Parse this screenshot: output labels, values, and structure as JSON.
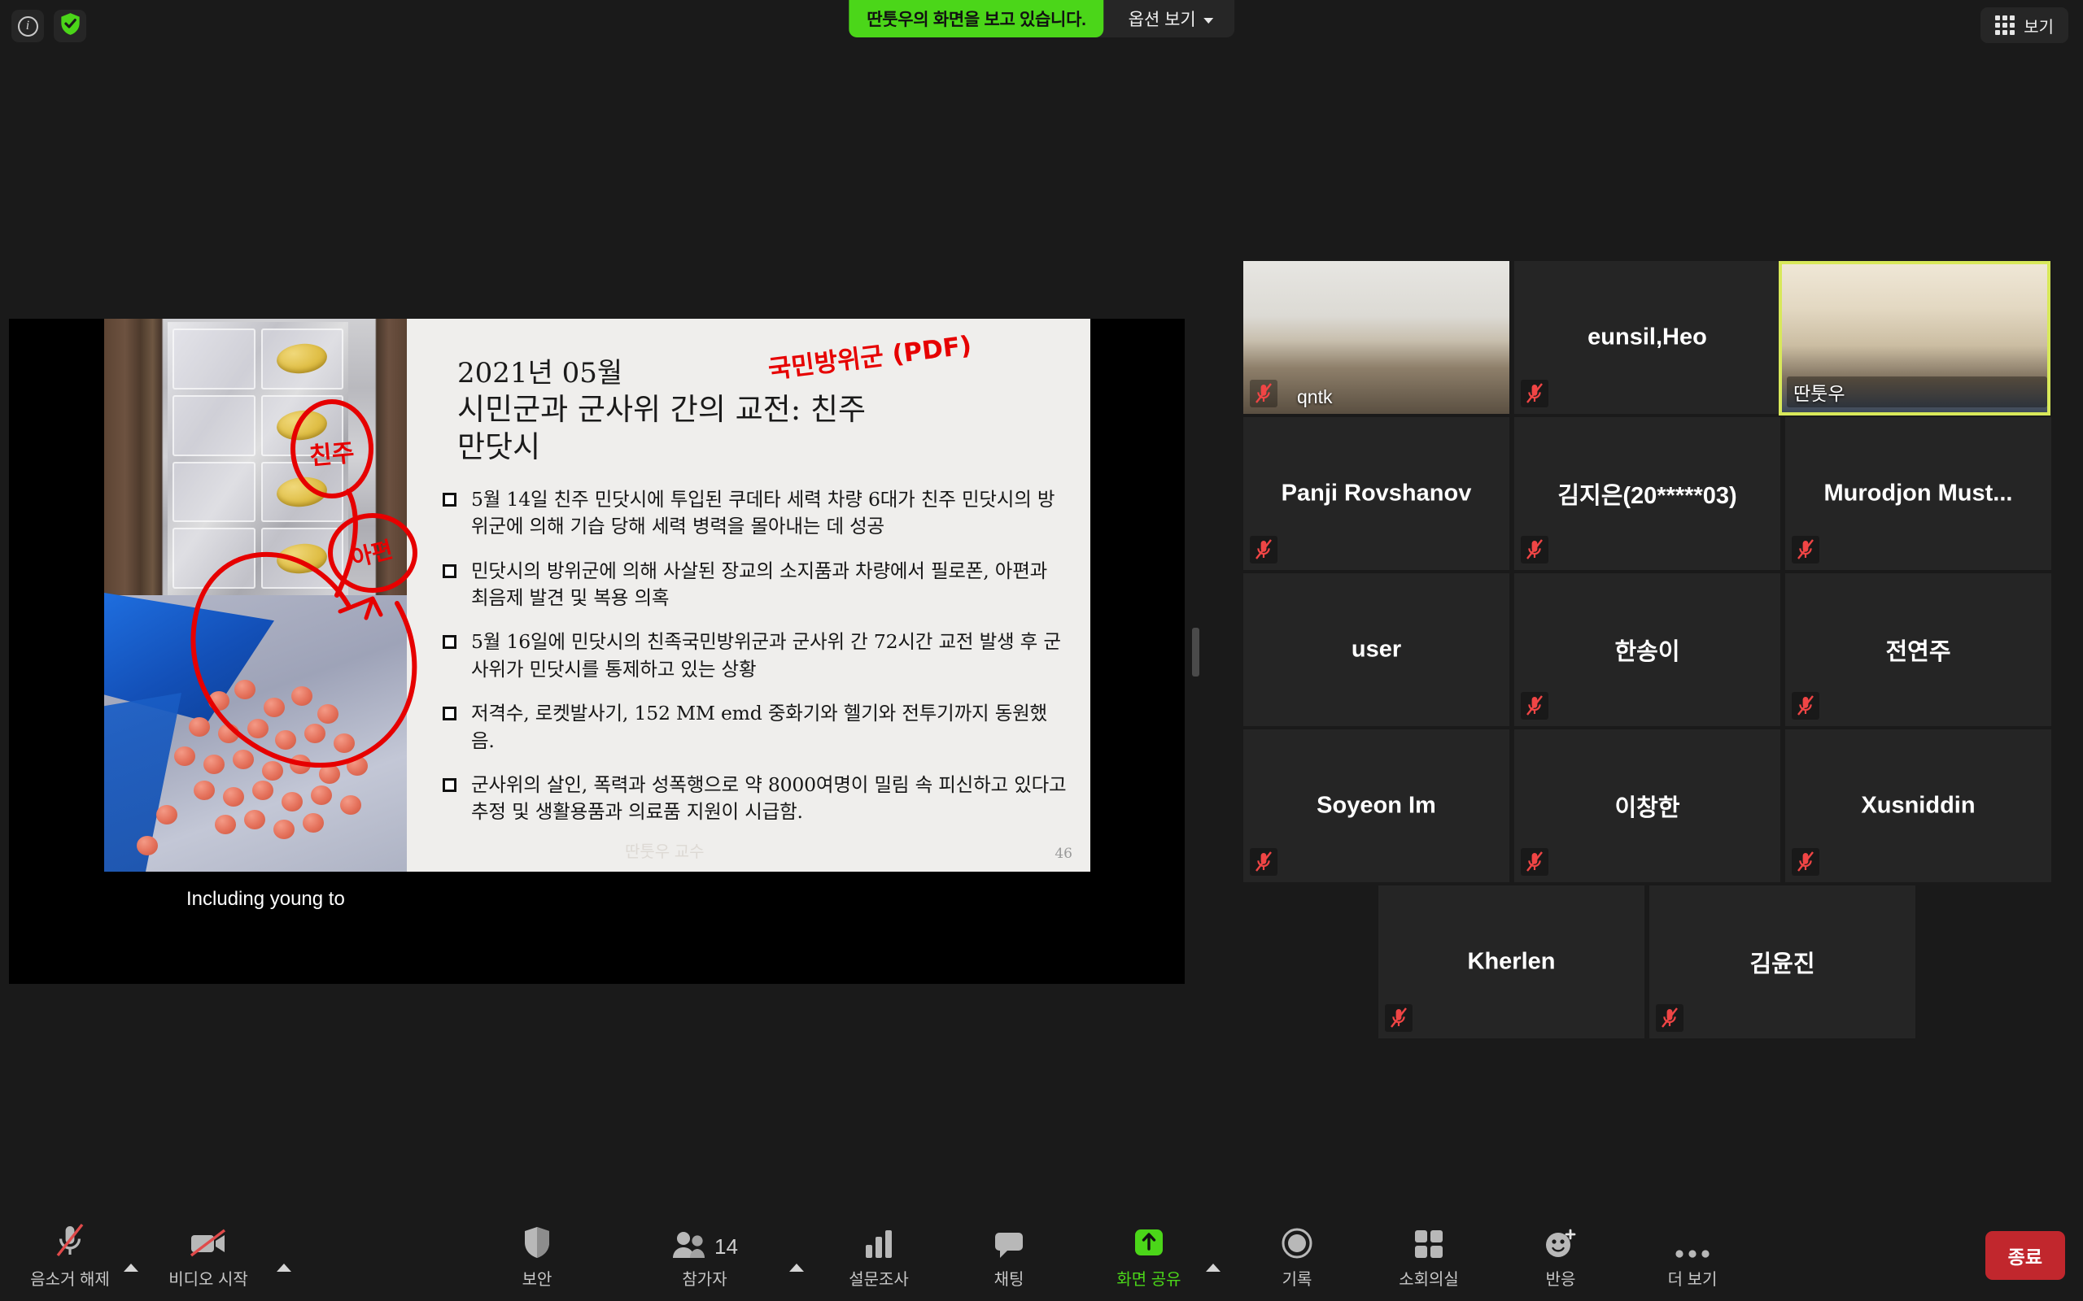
{
  "topbar": {
    "info_icon": "info-icon",
    "shield_icon": "shield-check-icon",
    "share_banner": "딴툿우의 화면을 보고 있습니다.",
    "options_label": "옵션 보기",
    "view_label": "보기"
  },
  "shared_screen": {
    "caption": "Including young to",
    "slide": {
      "title_line1": "2021년 05월",
      "title_line2": "시민군과 군사위 간의 교전: 친주",
      "title_line3": "만닷시",
      "page_number": "46",
      "watermark": "딴툿우 교수",
      "annotations": [
        {
          "text": "국민방위군 (PDF)",
          "kind": "handwriting-red"
        },
        {
          "text": "친주",
          "kind": "circled-red"
        },
        {
          "text": "아편",
          "kind": "circled-red"
        }
      ],
      "bullets": [
        "5월 14일 친주 민닷시에 투입된 쿠데타 세력 차량 6대가 친주 민닷시의 방위군에 의해 기습 당해 세력 병력을 몰아내는 데 성공",
        "민닷시의 방위군에 의해 사살된 장교의 소지품과 차량에서 필로폰, 아편과 최음제 발견 및 복용 의혹",
        "5월 16일에 민닷시의 친족국민방위군과 군사위 간 72시간 교전 발생 후 군사위가 민닷시를 통제하고 있는 상황",
        "저격수, 로켓발사기, 152 MM emd 중화기와 헬기와 전투기까지 동원했음.",
        "군사위의 살인, 폭력과 성폭행으로 약 8000여명이 밀림 속 피신하고 있다고 추정 및 생활용품과 의료품 지원이 시급함."
      ]
    }
  },
  "participants": [
    {
      "name": "qntk",
      "video": "classroom",
      "muted": true,
      "active": false
    },
    {
      "name": "eunsil,Heo",
      "video": "none",
      "muted": true,
      "active": false
    },
    {
      "name": "딴툿우",
      "video": "person",
      "muted": false,
      "active": true
    },
    {
      "name": "Panji Rovshanov",
      "video": "none",
      "muted": true,
      "active": false
    },
    {
      "name": "김지은(20*****03)",
      "video": "none",
      "muted": true,
      "active": false
    },
    {
      "name": "Murodjon Must...",
      "video": "none",
      "muted": true,
      "active": false
    },
    {
      "name": "user",
      "video": "none",
      "muted": false,
      "active": false
    },
    {
      "name": "한송이",
      "video": "none",
      "muted": true,
      "active": false
    },
    {
      "name": "전연주",
      "video": "none",
      "muted": true,
      "active": false
    },
    {
      "name": "Soyeon Im",
      "video": "none",
      "muted": true,
      "active": false
    },
    {
      "name": "이창한",
      "video": "none",
      "muted": true,
      "active": false
    },
    {
      "name": "Xusniddin",
      "video": "none",
      "muted": true,
      "active": false
    },
    {
      "name": "Kherlen",
      "video": "none",
      "muted": true,
      "active": false
    },
    {
      "name": "김윤진",
      "video": "none",
      "muted": true,
      "active": false
    }
  ],
  "toolbar": {
    "unmute_label": "음소거 해제",
    "start_video_label": "비디오 시작",
    "security_label": "보안",
    "participants_label": "참가자",
    "participants_count": "14",
    "polls_label": "설문조사",
    "chat_label": "채팅",
    "share_label": "화면 공유",
    "record_label": "기록",
    "breakout_label": "소회의실",
    "reactions_label": "반응",
    "more_label": "더 보기",
    "end_label": "종료"
  },
  "colors": {
    "accent_green": "#4bd619",
    "end_red": "#c1272d",
    "active_speaker": "#d8e85a",
    "mute_red": "#f04545"
  }
}
